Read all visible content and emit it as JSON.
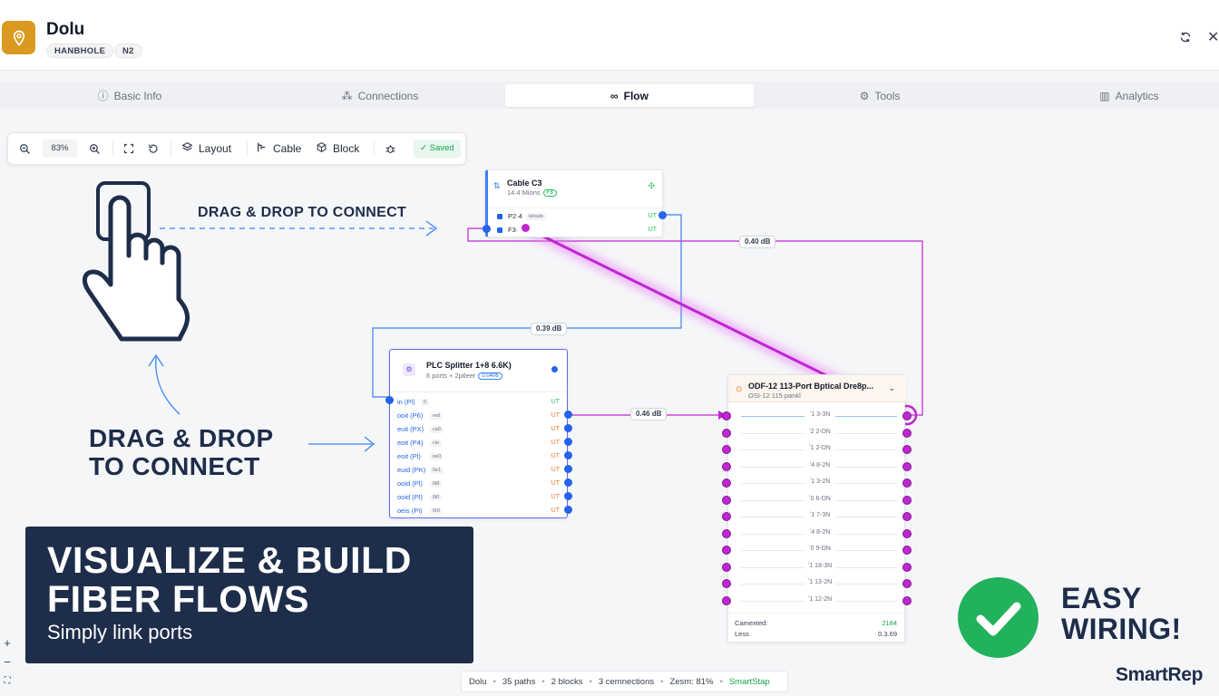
{
  "header": {
    "title": "Dolu",
    "badges": [
      "HANBHOLE",
      "N2"
    ],
    "icons": {
      "logo": "map-pin-icon",
      "refresh": "refresh-icon",
      "close": "close-icon"
    },
    "accent": "#d99a1f"
  },
  "tabs": [
    {
      "label": "Basic Info",
      "icon": "info-icon",
      "active": false
    },
    {
      "label": "Connections",
      "icon": "connections-icon",
      "active": false
    },
    {
      "label": "Flow",
      "icon": "flow-icon",
      "active": true
    },
    {
      "label": "Tools",
      "icon": "tools-icon",
      "active": false
    },
    {
      "label": "Analytics",
      "icon": "analytics-icon",
      "active": false
    }
  ],
  "toolbar": {
    "zoom": "83%",
    "layout_label": "Layout",
    "cable_label": "Cable",
    "block_label": "Block",
    "saved_label": "Saved"
  },
  "nodes": {
    "cable": {
      "title": "Cable C3",
      "subtitle": "14.4 Mions",
      "badge": "F8",
      "ports": [
        {
          "name": "P2·4",
          "tag": "lelouts",
          "dir": "UT"
        },
        {
          "name": "F3·",
          "tag": "",
          "dir": "UT"
        }
      ]
    },
    "splitter": {
      "title": "PLC Splitter 1+8 6.6K)",
      "subtitle": "6 ports + 2ptleer",
      "badge": "0.0406",
      "input": {
        "name": "in (Pl)",
        "tag": "0",
        "dir": "UT"
      },
      "outputs": [
        {
          "name": "ooit (P6)",
          "tag": "red",
          "dir": "UT"
        },
        {
          "name": "euit (PX)",
          "tag": "ca0",
          "dir": "UT"
        },
        {
          "name": "eoit (P4)",
          "tag": "cie",
          "dir": "UT"
        },
        {
          "name": "eoit (Pl)",
          "tag": "oe0",
          "dir": "UT"
        },
        {
          "name": "euid (PK)",
          "tag": "0e1",
          "dir": "UT"
        },
        {
          "name": "ooid (Pl)",
          "tag": "0i8",
          "dir": "UT"
        },
        {
          "name": "ooid (Pl)",
          "tag": "0i0",
          "dir": "UT"
        },
        {
          "name": "oeis (Pi)",
          "tag": "0r0",
          "dir": "UT"
        }
      ]
    },
    "odf": {
      "title": "ODF-12 113-Port Bptical Dre8p...",
      "subtitle": "OSI-12 115 pankl",
      "rows": [
        "ʼ1 3-3N",
        "ʼ2 2-DN",
        "ʼ1 2-DN",
        "ʼ4 8-2N",
        "ʼ1 3-2N",
        "ʼ0 6-DN",
        "ʼ1 7-3N",
        "ʼ4 8-2N",
        "ʼ0 9-DN",
        "ʼ1 18-3N",
        "ʼ1 13-2N",
        "ʼ1 12-2N"
      ],
      "footer": [
        {
          "label": "Camexted:",
          "value": "2184"
        },
        {
          "label": "Less",
          "value": "0.3.69"
        }
      ]
    }
  },
  "edges": [
    {
      "label": "0.40 dB"
    },
    {
      "label": "0.39 dB"
    },
    {
      "label": "0.46 dB"
    }
  ],
  "callouts": {
    "drag_top": "DRAG & DROP TO CONNECT",
    "drag_big_line1": "DRAG & DROP",
    "drag_big_line2": "TO CONNECT",
    "banner_title_line1": "VISUALIZE & BUILD",
    "banner_title_line2": "FIBER FLOWS",
    "banner_sub": "Simply link ports",
    "easy_line1": "EASY",
    "easy_line2": "WIRING!",
    "brand": "SmartRep"
  },
  "statusbar": {
    "name": "Dolu",
    "paths": "35 paths",
    "blocks": "2 blocks",
    "connections": "3 cemnections",
    "zoom": "Zesm: 81%",
    "brand": "SmartStap"
  },
  "zoom_controls": [
    "+",
    "−",
    "⛶"
  ],
  "colors": {
    "wire_magenta": "#c026d3",
    "wire_blue": "#3b82f6",
    "port_blue": "#2563eb",
    "success": "#22b25c",
    "navy": "#1e2d4a"
  }
}
